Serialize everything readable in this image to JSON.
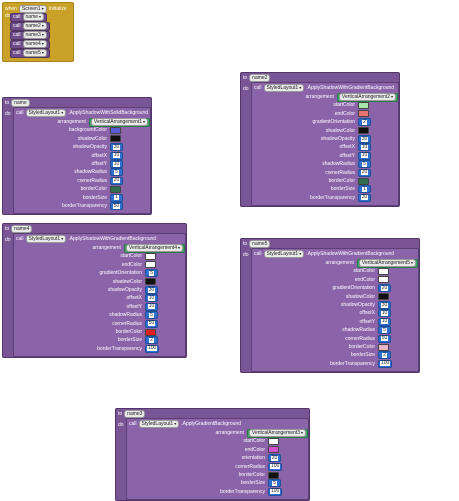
{
  "init": {
    "when": "when",
    "component": "Screen1",
    "event": "Initialize",
    "do": "do",
    "calls": [
      "name",
      "name2",
      "name3",
      "name4",
      "name5"
    ],
    "call_word": "call"
  },
  "words": {
    "to": "to",
    "do": "do",
    "call": "call",
    "styled": "StyledLayout1"
  },
  "colors": {
    "event": "#c9a227",
    "procedure": "#7a5596",
    "number": "#2f6fcf",
    "component": "#3fa66a"
  },
  "blocks": [
    {
      "proc": "name",
      "method": "ApplyShadowWithSolidBackground",
      "params": [
        {
          "label": "arrangement",
          "type": "comp",
          "value": "VerticalArrangement1"
        },
        {
          "label": "backgroundColor",
          "type": "color",
          "value": "#5b5bd6"
        },
        {
          "label": "shadowColor",
          "type": "color",
          "value": "#111111"
        },
        {
          "label": "shadowOpacity",
          "type": "num",
          "value": "30"
        },
        {
          "label": "offsetX",
          "type": "num",
          "value": "10"
        },
        {
          "label": "offsetY",
          "type": "num",
          "value": "10"
        },
        {
          "label": "shadowRadius",
          "type": "num",
          "value": "5"
        },
        {
          "label": "cornerRadius",
          "type": "num",
          "value": "20"
        },
        {
          "label": "borderColor",
          "type": "color",
          "value": "#2f6f4f"
        },
        {
          "label": "borderSize",
          "type": "num",
          "value": "1"
        },
        {
          "label": "borderTransparency",
          "type": "num",
          "value": "50"
        }
      ]
    },
    {
      "proc": "name2",
      "method": "ApplyShadowWithGradientBackground",
      "params": [
        {
          "label": "arrangement",
          "type": "comp",
          "value": "VerticalArrangement2"
        },
        {
          "label": "startColor",
          "type": "color",
          "value": "#a8e6a8"
        },
        {
          "label": "endColor",
          "type": "color",
          "value": "#e57373"
        },
        {
          "label": "gradientOrientation",
          "type": "num",
          "value": "2"
        },
        {
          "label": "shadowColor",
          "type": "color",
          "value": "#111111"
        },
        {
          "label": "shadowOpacity",
          "type": "num",
          "value": "30"
        },
        {
          "label": "offsetX",
          "type": "num",
          "value": "10"
        },
        {
          "label": "offsetY",
          "type": "num",
          "value": "10"
        },
        {
          "label": "shadowRadius",
          "type": "num",
          "value": "5"
        },
        {
          "label": "cornerRadius",
          "type": "num",
          "value": "20"
        },
        {
          "label": "borderColor",
          "type": "color",
          "value": "#2f6f4f"
        },
        {
          "label": "borderSize",
          "type": "num",
          "value": "1"
        },
        {
          "label": "borderTransparency",
          "type": "num",
          "value": "30"
        }
      ]
    },
    {
      "proc": "name4",
      "method": "ApplyShadowWithGradientBackground",
      "params": [
        {
          "label": "arrangement",
          "type": "comp",
          "value": "VerticalArrangement4"
        },
        {
          "label": "startColor",
          "type": "color",
          "value": "#ffffff"
        },
        {
          "label": "endColor",
          "type": "color",
          "value": "#ffffff"
        },
        {
          "label": "gradientOrientation",
          "type": "num",
          "value": "5"
        },
        {
          "label": "shadowColor",
          "type": "color",
          "value": "#111111"
        },
        {
          "label": "shadowOpacity",
          "type": "num",
          "value": "30"
        },
        {
          "label": "offsetX",
          "type": "num",
          "value": "10"
        },
        {
          "label": "offsetY",
          "type": "num",
          "value": "10"
        },
        {
          "label": "shadowRadius",
          "type": "num",
          "value": "5"
        },
        {
          "label": "cornerRadius",
          "type": "num",
          "value": "50"
        },
        {
          "label": "borderColor",
          "type": "color",
          "value": "#e02020"
        },
        {
          "label": "borderSize",
          "type": "num",
          "value": "2"
        },
        {
          "label": "borderTransparency",
          "type": "num",
          "value": "100"
        }
      ]
    },
    {
      "proc": "name5",
      "method": "ApplyShadowWithGradientBackground",
      "params": [
        {
          "label": "arrangement",
          "type": "comp",
          "value": "VerticalArrangement5"
        },
        {
          "label": "startColor",
          "type": "color",
          "value": "#ffffff"
        },
        {
          "label": "endColor",
          "type": "color",
          "value": "#ffffff"
        },
        {
          "label": "gradientOrientation",
          "type": "num",
          "value": "20"
        },
        {
          "label": "shadowColor",
          "type": "color",
          "value": "#111111"
        },
        {
          "label": "shadowOpacity",
          "type": "num",
          "value": "30"
        },
        {
          "label": "offsetX",
          "type": "num",
          "value": "10"
        },
        {
          "label": "offsetY",
          "type": "num",
          "value": "10"
        },
        {
          "label": "shadowRadius",
          "type": "num",
          "value": "5"
        },
        {
          "label": "cornerRadius",
          "type": "num",
          "value": "50"
        },
        {
          "label": "borderColor",
          "type": "color",
          "value": "#e8b4c8"
        },
        {
          "label": "borderSize",
          "type": "num",
          "value": "2"
        },
        {
          "label": "borderTransparency",
          "type": "num",
          "value": "100"
        }
      ]
    },
    {
      "proc": "name3",
      "method": "ApplyGradientBackground",
      "params": [
        {
          "label": "arrangement",
          "type": "comp",
          "value": "VerticalArrangement3"
        },
        {
          "label": "startColor",
          "type": "color",
          "value": "#ffffff"
        },
        {
          "label": "endColor",
          "type": "color",
          "value": "#d050d0"
        },
        {
          "label": "orientation",
          "type": "num",
          "value": "20"
        },
        {
          "label": "cornerRadius",
          "type": "num",
          "value": "100"
        },
        {
          "label": "borderColor",
          "type": "color",
          "value": "#111111"
        },
        {
          "label": "borderSize",
          "type": "num",
          "value": "5"
        },
        {
          "label": "borderTransparency",
          "type": "num",
          "value": "100"
        }
      ]
    }
  ]
}
